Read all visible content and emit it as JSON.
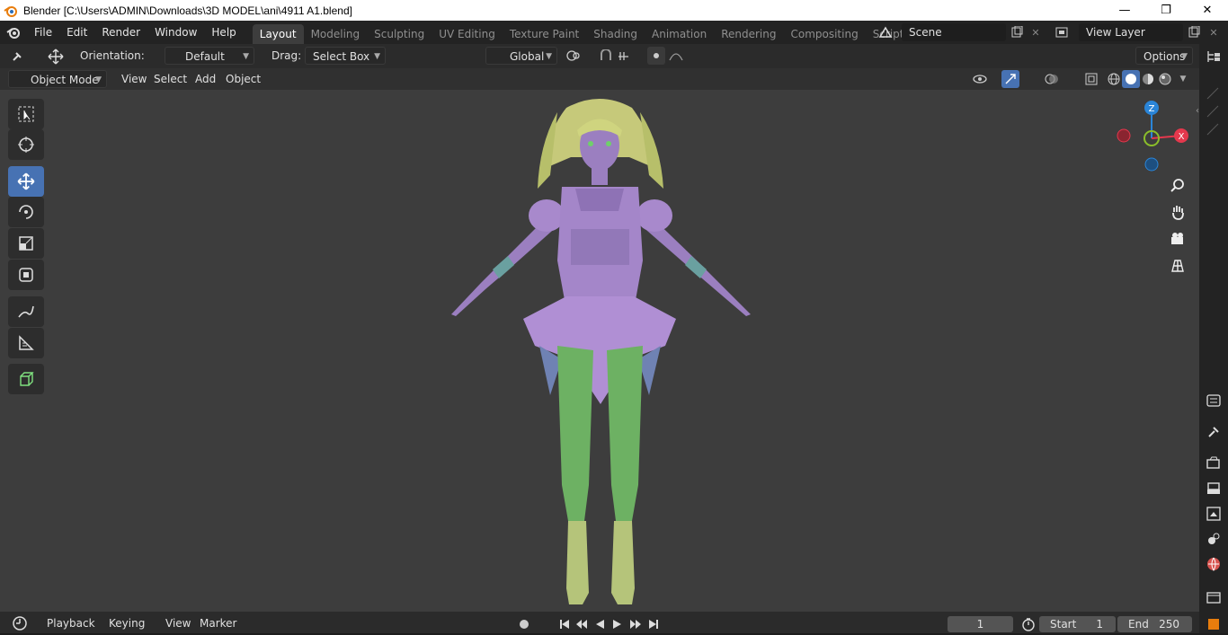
{
  "window": {
    "title": "Blender [C:\\Users\\ADMIN\\Downloads\\3D MODEL\\ani\\4911 A1.blend]",
    "minimize": "—",
    "maximize": "❐",
    "close": "✕"
  },
  "menu": [
    "File",
    "Edit",
    "Render",
    "Window",
    "Help"
  ],
  "workspaces": [
    "Layout",
    "Modeling",
    "Sculpting",
    "UV Editing",
    "Texture Paint",
    "Shading",
    "Animation",
    "Rendering",
    "Compositing",
    "Scripting"
  ],
  "active_workspace": "Layout",
  "add_workspace": "+",
  "scene": {
    "value": "Scene"
  },
  "view_layer": {
    "value": "View Layer"
  },
  "header": {
    "orientation_label": "Orientation:",
    "orientation_value": "Default",
    "drag_label": "Drag:",
    "drag_value": "Select Box",
    "transform_orientation": "Global",
    "options": "Options"
  },
  "header2": {
    "mode": "Object Mode",
    "menus": [
      "View",
      "Select",
      "Add",
      "Object"
    ]
  },
  "gizmo": {
    "z": "Z",
    "x": "X",
    "colors": {
      "x": "#e4384d",
      "y": "#8bbe2a",
      "z": "#2a85d8"
    }
  },
  "tools": [
    "select-box-icon",
    "cursor-icon",
    "move-icon",
    "rotate-icon",
    "scale-icon",
    "transform-icon",
    "annotate-icon",
    "measure-icon",
    "add-cube-icon"
  ],
  "active_tool": "move-icon",
  "timeline": {
    "menus": [
      "Playback",
      "Keying",
      "View",
      "Marker"
    ],
    "current_frame": "1",
    "start_label": "Start",
    "start_value": "1",
    "end_label": "End",
    "end_value": "250"
  },
  "colors": {
    "accent": "#4772b3",
    "viewport": "#3d3d3d"
  }
}
